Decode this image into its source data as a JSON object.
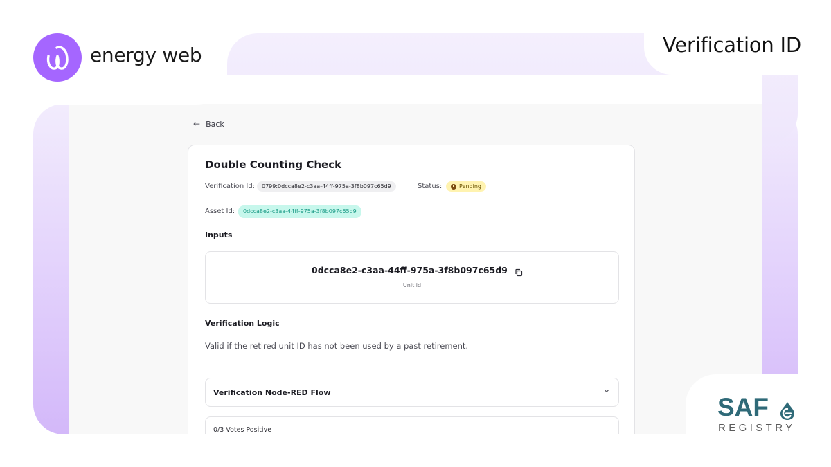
{
  "brand": {
    "wordmark": "energy web",
    "accent": "#a566ff",
    "icon": "energy-web-swirl-icon"
  },
  "slide": {
    "title": "Verification ID"
  },
  "registry_logo": {
    "saf": "SAF",
    "registry": "REGISTRY",
    "color": "#2f6a78",
    "icon": "fuel-drop-icon"
  },
  "page": {
    "back_label": "Back",
    "card": {
      "title": "Double Counting Check",
      "verification_id_label": "Verification Id:",
      "verification_id_value": "0799:0dcca8e2-c3aa-44ff-975a-3f8b097c65d9",
      "status_label": "Status:",
      "status_value": "Pending",
      "status_color": "#fff3b0",
      "asset_id_label": "Asset Id:",
      "asset_id_value": "0dcca8e2-c3aa-44ff-975a-3f8b097c65d9",
      "inputs_title": "Inputs",
      "unit_id_value": "0dcca8e2-c3aa-44ff-975a-3f8b097c65d9",
      "unit_id_caption": "Unit id",
      "logic_title": "Verification Logic",
      "logic_text": "Valid if the retired unit ID has not been used by a past retirement.",
      "flow_label": "Verification Node-RED Flow",
      "votes_label": "0/3 Votes Positive"
    }
  }
}
